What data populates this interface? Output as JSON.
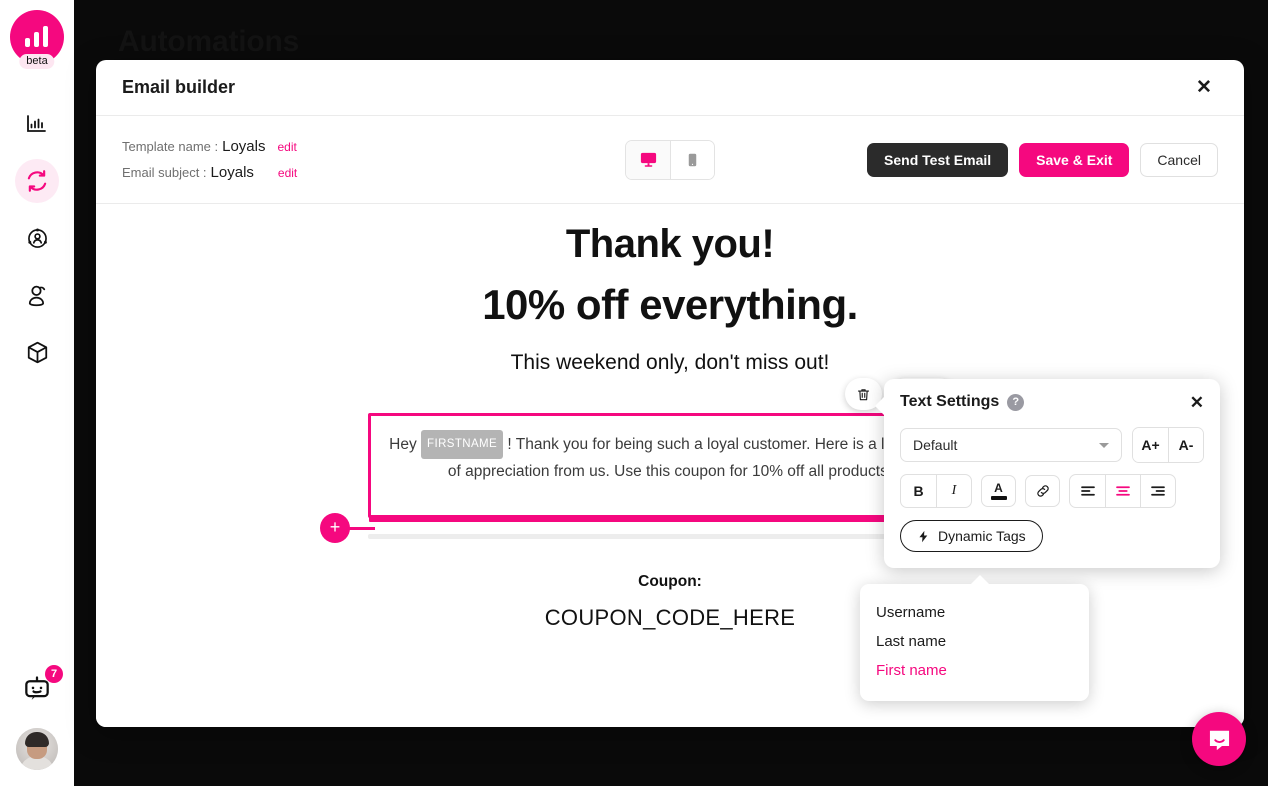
{
  "app": {
    "brand_color": "#F5087F",
    "beta_label": "beta",
    "page_title": "Automations",
    "notifications_count": "7"
  },
  "sidebar": {
    "items": [
      {
        "name": "analytics",
        "icon": "bar-chart-icon",
        "active": false
      },
      {
        "name": "automations",
        "icon": "refresh-cycle-icon",
        "active": true
      },
      {
        "name": "audience",
        "icon": "user-network-icon",
        "active": false
      },
      {
        "name": "segments",
        "icon": "person-pin-icon",
        "active": false
      },
      {
        "name": "products",
        "icon": "cube-icon",
        "active": false
      }
    ],
    "bot_icon": "chat-bot-icon",
    "avatar_icon": "user-avatar"
  },
  "modal": {
    "title": "Email builder",
    "close_label": "✕"
  },
  "builder": {
    "template_name_label": "Template name :",
    "template_name_value": "Loyals",
    "template_name_edit": "edit",
    "email_subject_label": "Email subject :",
    "email_subject_value": "Loyals",
    "email_subject_edit": "edit",
    "device_desktop_icon": "desktop-monitor-icon",
    "device_mobile_icon": "mobile-phone-icon",
    "device_selected": "desktop",
    "send_test_label": "Send Test Email",
    "save_exit_label": "Save & Exit",
    "cancel_label": "Cancel"
  },
  "email": {
    "heading_1": "Thank you!",
    "heading_2": "10% off everything.",
    "subheading": "This weekend only, don't miss out!",
    "body_before_tag": "Hey",
    "body_tag": "FIRSTNAME",
    "body_after_tag": "! Thank you for being such a loyal customer. Here is a little token of appreciation from us. Use this coupon for 10% off all products:",
    "coupon_label": "Coupon:",
    "coupon_code": "COUPON_CODE_HERE",
    "add_block_label": "+",
    "tool_delete_icon": "trash-icon",
    "tool_duplicate_icon": "duplicate-icon",
    "tool_settings_icon": "gear-icon"
  },
  "text_settings": {
    "title": "Text Settings",
    "help_label": "?",
    "close_label": "✕",
    "font_value": "Default",
    "font_options": [
      "Default"
    ],
    "increase_size_label": "A+",
    "decrease_size_label": "A-",
    "bold_label": "B",
    "italic_label": "I",
    "font_color_label": "A",
    "link_icon": "link-icon",
    "align_left_icon": "align-left-icon",
    "align_center_icon": "align-center-icon",
    "align_right_icon": "align-right-icon",
    "align_selected": "center",
    "dynamic_tags_label": "Dynamic Tags",
    "dynamic_tags_icon": "lightning-bolt-icon"
  },
  "dynamic_tags_menu": {
    "items": [
      {
        "label": "Username",
        "selected": false
      },
      {
        "label": "Last name",
        "selected": false
      },
      {
        "label": "First name",
        "selected": true
      }
    ]
  },
  "intercom": {
    "icon": "intercom-chat-icon"
  }
}
